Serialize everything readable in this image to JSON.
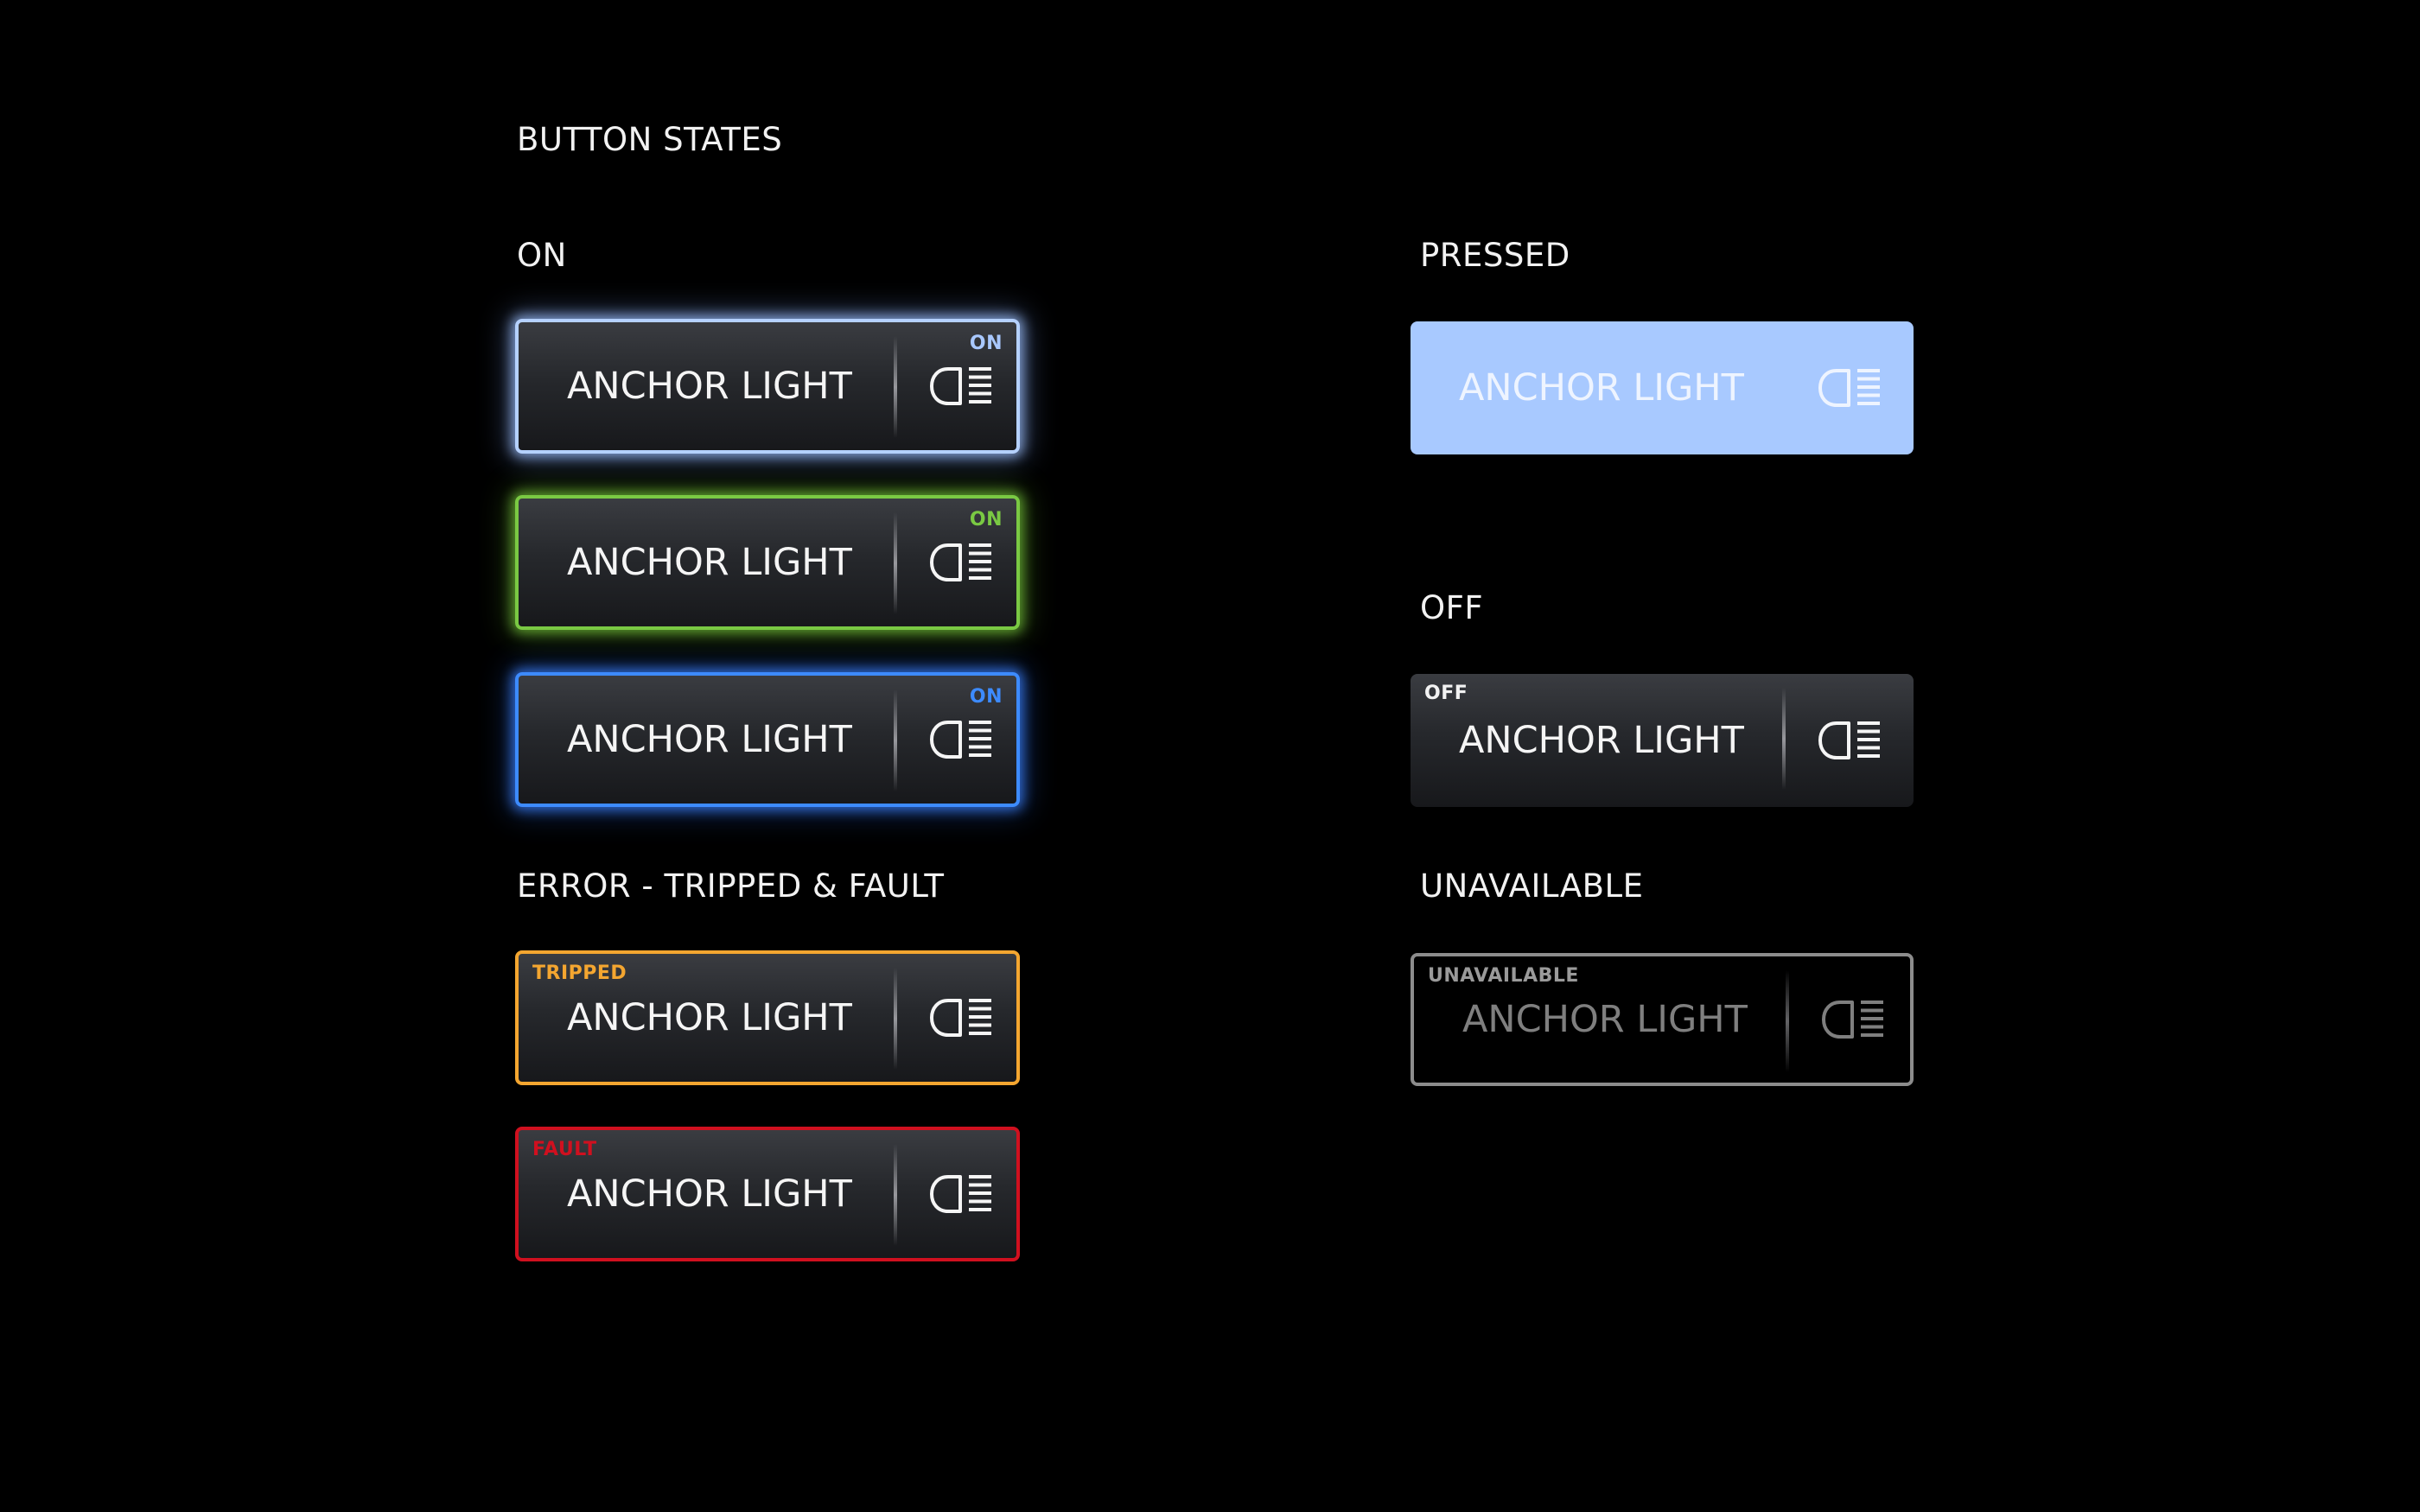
{
  "page": {
    "title": "BUTTON STATES"
  },
  "sections": {
    "on": "ON",
    "pressed": "PRESSED",
    "off": "OFF",
    "error": "ERROR - TRIPPED & FAULT",
    "unavailable": "UNAVAILABLE"
  },
  "buttons": [
    {
      "state": "on",
      "variant": "light-blue",
      "label": "ANCHOR LIGHT",
      "badge": "ON",
      "icon": "headlight-icon",
      "accent": "#b5d1ff"
    },
    {
      "state": "on",
      "variant": "green",
      "label": "ANCHOR LIGHT",
      "badge": "ON",
      "icon": "headlight-icon",
      "accent": "#7ac943"
    },
    {
      "state": "on",
      "variant": "blue",
      "label": "ANCHOR LIGHT",
      "badge": "ON",
      "icon": "headlight-icon",
      "accent": "#3d8bff"
    },
    {
      "state": "tripped",
      "label": "ANCHOR LIGHT",
      "badge": "TRIPPED",
      "icon": "headlight-icon",
      "accent": "#f4a630"
    },
    {
      "state": "fault",
      "label": "ANCHOR LIGHT",
      "badge": "FAULT",
      "icon": "headlight-icon",
      "accent": "#d0101f"
    },
    {
      "state": "pressed",
      "label": "ANCHOR LIGHT",
      "icon": "headlight-icon",
      "accent": "#a8c9ff"
    },
    {
      "state": "off",
      "label": "ANCHOR LIGHT",
      "badge": "OFF",
      "icon": "headlight-icon"
    },
    {
      "state": "unavailable",
      "label": "ANCHOR LIGHT",
      "badge": "UNAVAILABLE",
      "icon": "headlight-icon",
      "accent": "#8c8c8c"
    }
  ]
}
